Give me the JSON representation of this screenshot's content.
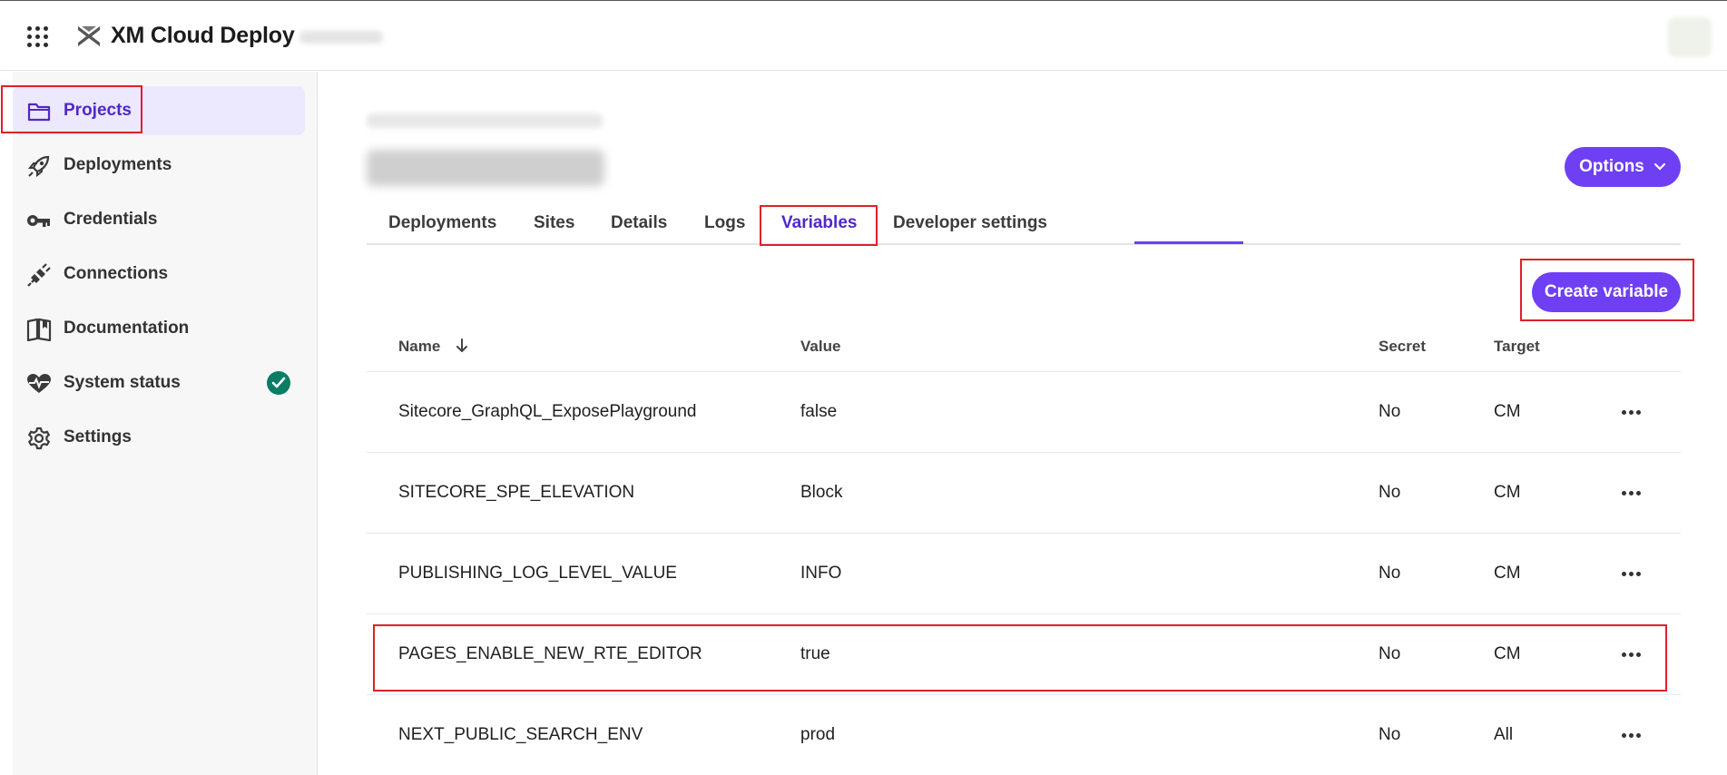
{
  "app": {
    "title": "XM Cloud Deploy"
  },
  "sidebar": {
    "items": [
      {
        "label": "Projects",
        "icon": "folder-icon",
        "active": true
      },
      {
        "label": "Deployments",
        "icon": "rocket-icon"
      },
      {
        "label": "Credentials",
        "icon": "key-icon"
      },
      {
        "label": "Connections",
        "icon": "plug-icon"
      },
      {
        "label": "Documentation",
        "icon": "book-icon"
      },
      {
        "label": "System status",
        "icon": "heartbeat-icon",
        "status_icon": "check-circle-icon"
      },
      {
        "label": "Settings",
        "icon": "gear-icon"
      }
    ]
  },
  "header": {
    "options_label": "Options"
  },
  "tabs": [
    {
      "label": "Deployments"
    },
    {
      "label": "Sites"
    },
    {
      "label": "Details"
    },
    {
      "label": "Logs"
    },
    {
      "label": "Variables",
      "active": true
    },
    {
      "label": "Developer settings"
    }
  ],
  "actions": {
    "create_variable_label": "Create variable"
  },
  "table": {
    "columns": {
      "name": "Name",
      "value": "Value",
      "secret": "Secret",
      "target": "Target"
    },
    "rows": [
      {
        "name": "Sitecore_GraphQL_ExposePlayground",
        "value": "false",
        "secret": "No",
        "target": "CM"
      },
      {
        "name": "SITECORE_SPE_ELEVATION",
        "value": "Block",
        "secret": "No",
        "target": "CM"
      },
      {
        "name": "PUBLISHING_LOG_LEVEL_VALUE",
        "value": "INFO",
        "secret": "No",
        "target": "CM"
      },
      {
        "name": "PAGES_ENABLE_NEW_RTE_EDITOR",
        "value": "true",
        "secret": "No",
        "target": "CM"
      },
      {
        "name": "NEXT_PUBLIC_SEARCH_ENV",
        "value": "prod",
        "secret": "No",
        "target": "All"
      }
    ]
  },
  "colors": {
    "accent": "#6e3ff3",
    "active_text": "#5028c8",
    "active_bg": "#ece8fd",
    "highlight": "#e0202a",
    "status_ok": "#0b7d64"
  }
}
